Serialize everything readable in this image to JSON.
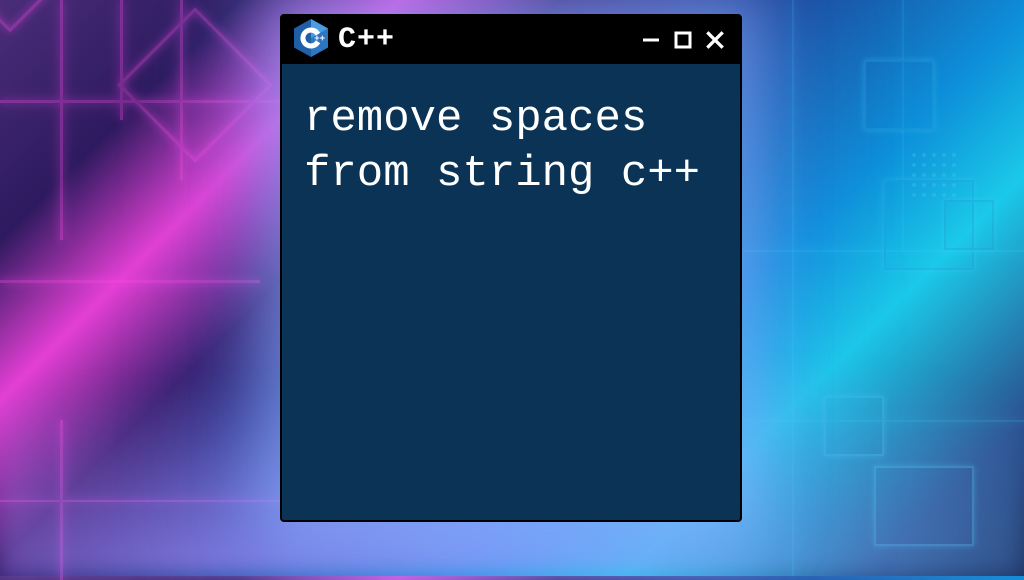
{
  "window": {
    "title": "C++",
    "content": "remove spaces from string c++"
  },
  "colors": {
    "window_bg": "#0a3355",
    "titlebar_bg": "#000000",
    "text": "#ffffff",
    "logo_primary": "#1e5fa8",
    "logo_secondary": "#3b8ed8"
  }
}
